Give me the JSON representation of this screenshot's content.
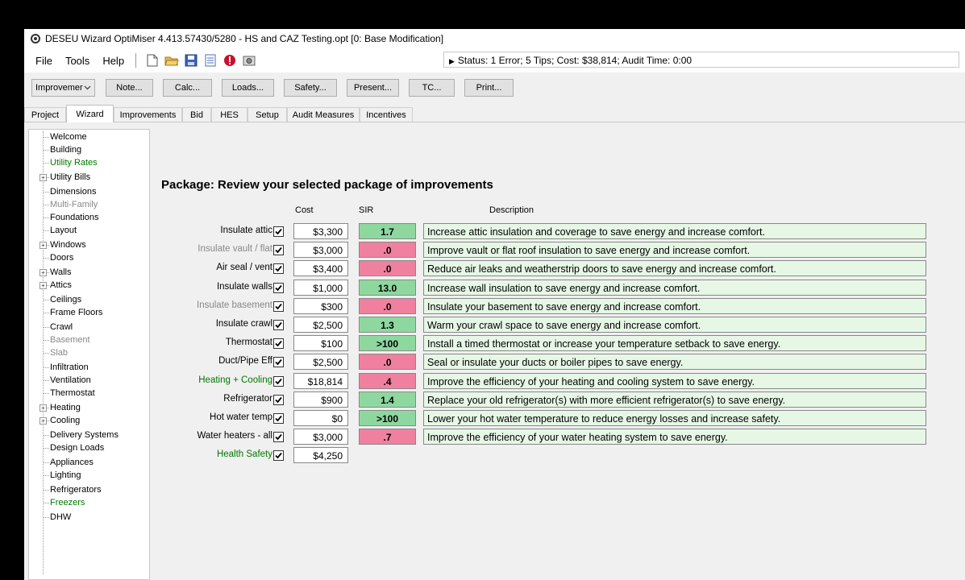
{
  "window": {
    "title": "DESEU Wizard OptiMiser 4.413.57430/5280 - HS and CAZ Testing.opt [0: Base Modification]"
  },
  "menu": {
    "items": [
      "File",
      "Tools",
      "Help"
    ],
    "status": "Status: 1 Error; 5 Tips; Cost: $38,814; Audit Time: 0:00"
  },
  "toolbar": {
    "combo_value": "Improvemer",
    "buttons": [
      "Note...",
      "Calc...",
      "Loads...",
      "Safety...",
      "Present...",
      "TC...",
      "Print..."
    ]
  },
  "tabs": [
    "Project",
    "Wizard",
    "Improvements",
    "Bid",
    "HES",
    "Setup",
    "Audit Measures",
    "Incentives"
  ],
  "active_tab": "Wizard",
  "tree": [
    {
      "label": "Welcome",
      "state": "normal",
      "expandable": false
    },
    {
      "label": "Building",
      "state": "normal",
      "expandable": false
    },
    {
      "label": "Utility Rates",
      "state": "green",
      "expandable": false
    },
    {
      "label": "Utility Bills",
      "state": "normal",
      "expandable": true
    },
    {
      "label": "Dimensions",
      "state": "normal",
      "expandable": false
    },
    {
      "label": "Multi-Family",
      "state": "gray",
      "expandable": false
    },
    {
      "label": "Foundations",
      "state": "normal",
      "expandable": false
    },
    {
      "label": "Layout",
      "state": "normal",
      "expandable": false
    },
    {
      "label": "Windows",
      "state": "normal",
      "expandable": true
    },
    {
      "label": "Doors",
      "state": "normal",
      "expandable": false
    },
    {
      "label": "Walls",
      "state": "normal",
      "expandable": true
    },
    {
      "label": "Attics",
      "state": "normal",
      "expandable": true
    },
    {
      "label": "Ceilings",
      "state": "normal",
      "expandable": false
    },
    {
      "label": "Frame Floors",
      "state": "normal",
      "expandable": false
    },
    {
      "label": "Crawl",
      "state": "normal",
      "expandable": false
    },
    {
      "label": "Basement",
      "state": "gray",
      "expandable": false
    },
    {
      "label": "Slab",
      "state": "gray",
      "expandable": false
    },
    {
      "label": "Infiltration",
      "state": "normal",
      "expandable": false
    },
    {
      "label": "Ventilation",
      "state": "normal",
      "expandable": false
    },
    {
      "label": "Thermostat",
      "state": "normal",
      "expandable": false
    },
    {
      "label": "Heating",
      "state": "normal",
      "expandable": true
    },
    {
      "label": "Cooling",
      "state": "normal",
      "expandable": true
    },
    {
      "label": "Delivery Systems",
      "state": "normal",
      "expandable": false
    },
    {
      "label": "Design Loads",
      "state": "normal",
      "expandable": false
    },
    {
      "label": "Appliances",
      "state": "normal",
      "expandable": false
    },
    {
      "label": "Lighting",
      "state": "normal",
      "expandable": false
    },
    {
      "label": "Refrigerators",
      "state": "normal",
      "expandable": false
    },
    {
      "label": "Freezers",
      "state": "green",
      "expandable": false
    },
    {
      "label": "DHW",
      "state": "normal",
      "expandable": false
    }
  ],
  "package": {
    "title": "Package: Review your selected package of improvements",
    "col_cost": "Cost",
    "col_sir": "SIR",
    "col_desc": "Description",
    "rows": [
      {
        "label": "Insulate attic",
        "label_state": "normal",
        "checked": true,
        "cost": "$3,300",
        "sir": "1.7",
        "sir_state": "good",
        "description": "Increase attic insulation and coverage to save energy and increase comfort."
      },
      {
        "label": "Insulate vault / flat",
        "label_state": "gray",
        "checked": true,
        "cost": "$3,000",
        "sir": ".0",
        "sir_state": "bad",
        "description": "Improve vault or flat roof insulation to save energy and increase comfort."
      },
      {
        "label": "Air seal / vent",
        "label_state": "normal",
        "checked": true,
        "cost": "$3,400",
        "sir": ".0",
        "sir_state": "bad",
        "description": "Reduce air leaks and weatherstrip doors to save energy and increase comfort."
      },
      {
        "label": "Insulate walls",
        "label_state": "normal",
        "checked": true,
        "cost": "$1,000",
        "sir": "13.0",
        "sir_state": "good",
        "description": "Increase wall insulation to save energy and increase comfort."
      },
      {
        "label": "Insulate basement",
        "label_state": "gray",
        "checked": true,
        "cost": "$300",
        "sir": ".0",
        "sir_state": "bad",
        "description": "Insulate your basement to save energy and increase comfort."
      },
      {
        "label": "Insulate crawl",
        "label_state": "normal",
        "checked": true,
        "cost": "$2,500",
        "sir": "1.3",
        "sir_state": "good",
        "description": "Warm your crawl space to save energy and increase comfort."
      },
      {
        "label": "Thermostat",
        "label_state": "normal",
        "checked": true,
        "cost": "$100",
        "sir": ">100",
        "sir_state": "good",
        "description": "Install a timed thermostat or increase your temperature setback to save energy."
      },
      {
        "label": "Duct/Pipe Eff",
        "label_state": "normal",
        "checked": true,
        "cost": "$2,500",
        "sir": ".0",
        "sir_state": "bad",
        "description": "Seal or insulate your ducts or boiler pipes to save energy."
      },
      {
        "label": "Heating + Cooling",
        "label_state": "green",
        "checked": true,
        "cost": "$18,814",
        "sir": ".4",
        "sir_state": "bad",
        "description": "Improve the efficiency of your heating and cooling system to save energy."
      },
      {
        "label": "Refrigerator",
        "label_state": "normal",
        "checked": true,
        "cost": "$900",
        "sir": "1.4",
        "sir_state": "good",
        "description": "Replace your old refrigerator(s) with more efficient refrigerator(s) to save energy."
      },
      {
        "label": "Hot water temp",
        "label_state": "normal",
        "checked": true,
        "cost": "$0",
        "sir": ">100",
        "sir_state": "good",
        "description": "Lower your hot water temperature to reduce energy losses and increase safety."
      },
      {
        "label": "Water heaters - all",
        "label_state": "normal",
        "checked": true,
        "cost": "$3,000",
        "sir": ".7",
        "sir_state": "bad",
        "description": "Improve the efficiency of your water heating system to save energy."
      },
      {
        "label": "Health  Safety",
        "label_state": "green",
        "checked": true,
        "cost": "$4,250",
        "sir": null,
        "sir_state": null,
        "description": null
      }
    ]
  },
  "colors": {
    "sir_good": "#8ed8a0",
    "sir_bad": "#f080a0",
    "desc_bg": "#e6f7e6",
    "label_green": "#007800",
    "label_gray": "#888888"
  }
}
